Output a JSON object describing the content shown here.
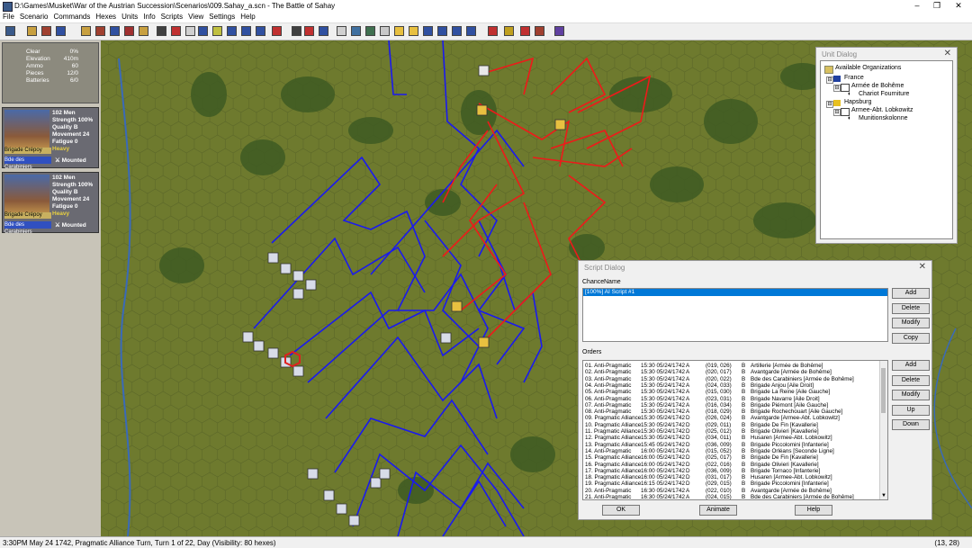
{
  "window": {
    "title": "D:\\Games\\Musket\\War of the Austrian Succession\\Scenarios\\009.Sahay_a.scn - The Battle of Sahay",
    "minimize": "–",
    "maximize": "❐",
    "close": "✕"
  },
  "menu": [
    "File",
    "Scenario",
    "Commands",
    "Hexes",
    "Units",
    "Info",
    "Scripts",
    "View",
    "Settings",
    "Help"
  ],
  "terrain": {
    "rows": [
      {
        "k": "Clear",
        "v": "0%"
      },
      {
        "k": "Elevation",
        "v": "410m"
      },
      {
        "k": "Ammo",
        "v": "60"
      },
      {
        "k": "Pieces",
        "v": "12/0"
      },
      {
        "k": "Batteries",
        "v": "6/0"
      }
    ]
  },
  "units": [
    {
      "men": "102 Men",
      "strength": "Strength 100%",
      "quality": "Quality B",
      "movement": "Movement 24",
      "fatigue": "Fatigue 0",
      "weight": "Heavy",
      "brigade": "Brigade Crépoy",
      "formation": "Bde des Carabiniers",
      "status": "Mounted"
    },
    {
      "men": "102 Men",
      "strength": "Strength 100%",
      "quality": "Quality B",
      "movement": "Movement 24",
      "fatigue": "Fatigue 0",
      "weight": "Heavy",
      "brigade": "Brigade Crépoy",
      "formation": "Bde des Carabiniers",
      "status": "Mounted"
    }
  ],
  "unit_dialog": {
    "title": "Unit Dialog",
    "close": "✕",
    "tree": [
      "Available Organizations",
      "France",
      "Armée de Bohême",
      "Chariot Fourniture",
      "Hapsburg",
      "Armee-Abt. Lobkowitz",
      "Munitionskolonne"
    ],
    "expanders": [
      "⊟",
      "⊟",
      "⊟",
      "⊟"
    ]
  },
  "script_dialog": {
    "title": "Script Dialog",
    "close": "✕",
    "header_chance": "Chance",
    "header_name": "Name",
    "scripts": [
      "[100%]  AI Script #1"
    ],
    "buttons": {
      "add": "Add",
      "delete": "Delete",
      "modify": "Modify",
      "copy": "Copy",
      "up": "Up",
      "down": "Down",
      "ok": "OK",
      "animate": "Animate",
      "help": "Help"
    },
    "orders_label": "Orders",
    "orders": [
      {
        "n": "01. Anti-Pragmatic",
        "t": "15:30 05/24/1742",
        "c": "A",
        "h": "(019, 026)",
        "r": "B",
        "u": "Artillerie  [Armée de Bohême]"
      },
      {
        "n": "02. Anti-Pragmatic",
        "t": "15:30 05/24/1742",
        "c": "A",
        "h": "(020, 017)",
        "r": "B",
        "u": "Avantgarde  [Armée de Bohême]"
      },
      {
        "n": "03. Anti-Pragmatic",
        "t": "15:30 05/24/1742",
        "c": "A",
        "h": "(020, 022)",
        "r": "B",
        "u": "Bde des Carabiniers  [Armée de Bohême]"
      },
      {
        "n": "04. Anti-Pragmatic",
        "t": "15:30 05/24/1742",
        "c": "A",
        "h": "(024, 033)",
        "r": "B",
        "u": "Brigade Anjou  [Aile Droit]"
      },
      {
        "n": "05. Anti-Pragmatic",
        "t": "15:30 05/24/1742",
        "c": "A",
        "h": "(015, 030)",
        "r": "B",
        "u": "Brigade La Reine  [Aile Gauche]"
      },
      {
        "n": "06. Anti-Pragmatic",
        "t": "15:30 05/24/1742",
        "c": "A",
        "h": "(023, 031)",
        "r": "B",
        "u": "Brigade Navarre  [Aile Droit]"
      },
      {
        "n": "07. Anti-Pragmatic",
        "t": "15:30 05/24/1742",
        "c": "A",
        "h": "(016, 034)",
        "r": "B",
        "u": "Brigade Piémont  [Aile Gauche]"
      },
      {
        "n": "08. Anti-Pragmatic",
        "t": "15:30 05/24/1742",
        "c": "A",
        "h": "(018, 029)",
        "r": "B",
        "u": "Brigade Rochechouart  [Aile Gauche]"
      },
      {
        "n": "09. Pragmatic Alliance",
        "t": "15:30 05/24/1742",
        "c": "D",
        "h": "(026, 024)",
        "r": "B",
        "u": "Avantgarde  [Armee-Abt. Lobkowitz]"
      },
      {
        "n": "10. Pragmatic Alliance",
        "t": "15:30 05/24/1742",
        "c": "D",
        "h": "(029, 011)",
        "r": "B",
        "u": "Brigade De Fin  [Kavallerie]"
      },
      {
        "n": "11. Pragmatic Alliance",
        "t": "15:30 05/24/1742",
        "c": "D",
        "h": "(025, 012)",
        "r": "B",
        "u": "Brigade Olivieri  [Kavallerie]"
      },
      {
        "n": "12. Pragmatic Alliance",
        "t": "15:30 05/24/1742",
        "c": "D",
        "h": "(034, 011)",
        "r": "B",
        "u": "Husaren  [Armee-Abt. Lobkowitz]"
      },
      {
        "n": "13. Pragmatic Alliance",
        "t": "15:45 05/24/1742",
        "c": "D",
        "h": "(036, 009)",
        "r": "B",
        "u": "Brigade Piccolomini  [Infanterie]"
      },
      {
        "n": "14. Anti-Pragmatic",
        "t": "16:00 05/24/1742",
        "c": "A",
        "h": "(015, 052)",
        "r": "B",
        "u": "Brigade Orléans  [Seconde Ligne]"
      },
      {
        "n": "15. Pragmatic Alliance",
        "t": "16:00 05/24/1742",
        "c": "D",
        "h": "(025, 017)",
        "r": "B",
        "u": "Brigade De Fin  [Kavallerie]"
      },
      {
        "n": "16. Pragmatic Alliance",
        "t": "16:00 05/24/1742",
        "c": "D",
        "h": "(022, 016)",
        "r": "B",
        "u": "Brigade Olivieri  [Kavallerie]"
      },
      {
        "n": "17. Pragmatic Alliance",
        "t": "16:00 05/24/1742",
        "c": "D",
        "h": "(036, 009)",
        "r": "B",
        "u": "Brigade Tornaco  [Infanterie]"
      },
      {
        "n": "18. Pragmatic Alliance",
        "t": "16:00 05/24/1742",
        "c": "D",
        "h": "(031, 017)",
        "r": "B",
        "u": "Husaren  [Armee-Abt. Lobkowitz]"
      },
      {
        "n": "19. Pragmatic Alliance",
        "t": "16:15 05/24/1742",
        "c": "D",
        "h": "(029, 015)",
        "r": "B",
        "u": "Brigade Piccolomini  [Infanterie]"
      },
      {
        "n": "20. Anti-Pragmatic",
        "t": "16:30 05/24/1742",
        "c": "A",
        "h": "(022, 010)",
        "r": "B",
        "u": "Avantgarde  [Armée de Bohême]"
      },
      {
        "n": "21. Anti-Pragmatic",
        "t": "16:30 05/24/1742",
        "c": "A",
        "h": "(024, 015)",
        "r": "B",
        "u": "Bde des Carabiniers  [Armée de Bohême]"
      }
    ]
  },
  "status": {
    "left": "3:30PM May 24 1742, Pragmatic Alliance Turn, Turn 1 of 22, Day (Visibility: 80 hexes)",
    "right": "(13, 28)"
  },
  "colors": {
    "map_ground": "#6e7a2e",
    "forest": "#3e5a22",
    "route_blue": "#1a1aee",
    "route_red": "#ee1a1a",
    "water": "#3a6ab8",
    "selection": "#0078d7"
  }
}
